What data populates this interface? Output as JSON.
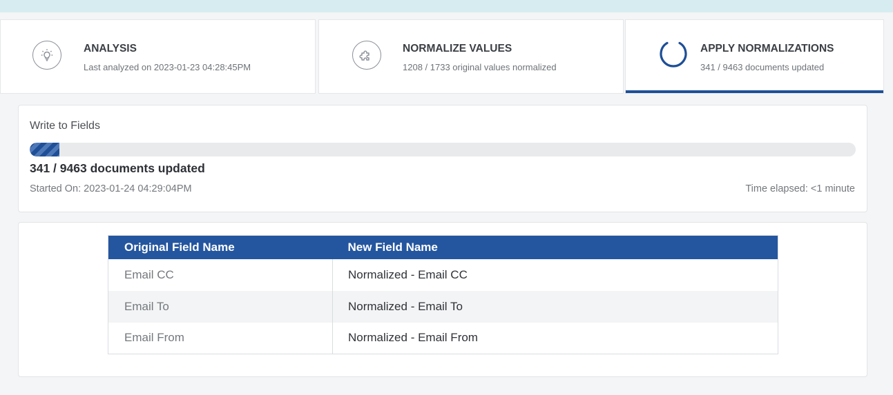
{
  "steps": [
    {
      "title": "ANALYSIS",
      "subtitle": "Last analyzed on 2023-01-23 04:28:45PM",
      "icon": "lightbulb-icon"
    },
    {
      "title": "NORMALIZE VALUES",
      "subtitle": "1208 / 1733 original values normalized",
      "icon": "puzzle-icon"
    },
    {
      "title": "APPLY NORMALIZATIONS",
      "subtitle": "341 / 9463 documents updated",
      "icon": "spinner-icon",
      "active": true
    }
  ],
  "progress": {
    "title": "Write to Fields",
    "fraction": 0.036,
    "count_label": "341 / 9463 documents updated",
    "started": "Started On: 2023-01-24 04:29:04PM",
    "elapsed": "Time elapsed: <1 minute"
  },
  "mapping_table": {
    "headers": [
      "Original Field Name",
      "New Field Name"
    ],
    "rows": [
      [
        "Email CC",
        "Normalized - Email CC"
      ],
      [
        "Email To",
        "Normalized - Email To"
      ],
      [
        "Email From",
        "Normalized - Email From"
      ]
    ]
  },
  "colors": {
    "accent": "#1e4f97",
    "table_header": "#24569f",
    "top_strip": "#d6ecf1"
  }
}
